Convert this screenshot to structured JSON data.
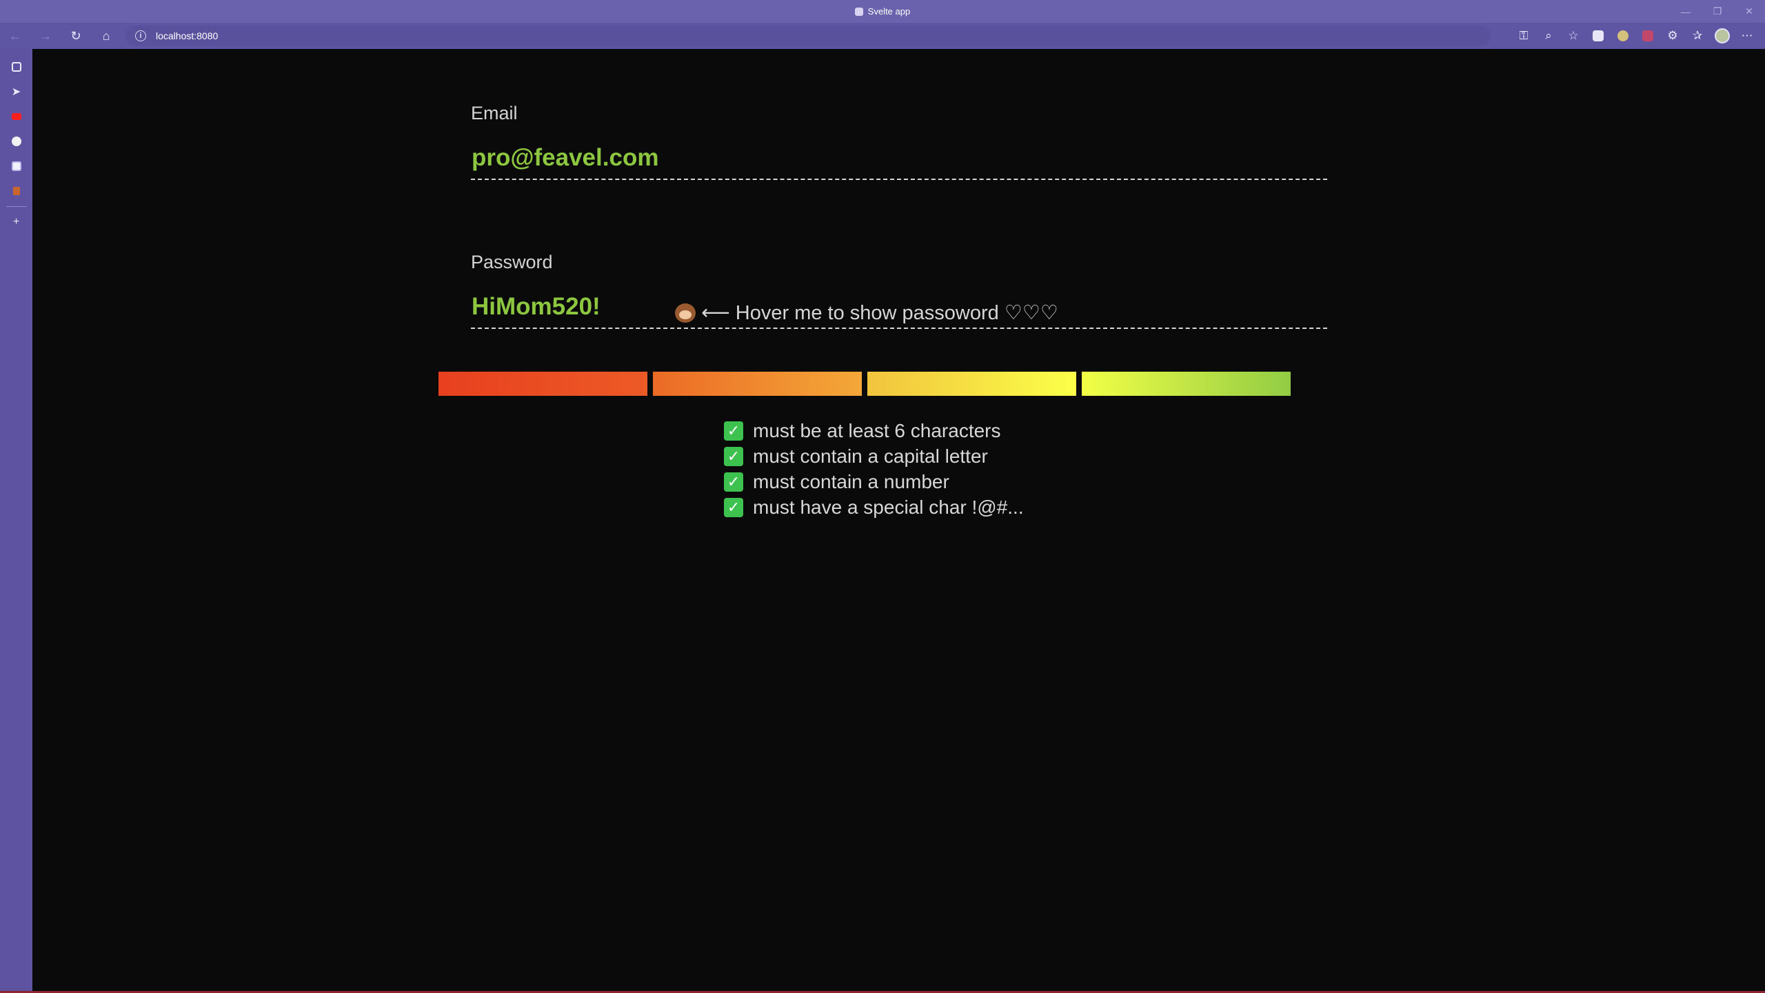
{
  "window": {
    "title": "Svelte app",
    "controls": [
      "—",
      "❐",
      "✕"
    ]
  },
  "toolbar": {
    "back": "←",
    "forward": "→",
    "reload": "↻",
    "home": "⌂",
    "url": "localhost:8080",
    "info": "i",
    "more": "⋯"
  },
  "sidebar": {
    "items": [
      "tab-manager",
      "sent",
      "youtube",
      "github",
      "svelte",
      "app"
    ],
    "add": "+"
  },
  "form": {
    "email_label": "Email",
    "email_value": "pro@feavel.com",
    "password_label": "Password",
    "password_value": "HiMom520!"
  },
  "hint": {
    "text": "⟵ Hover me to show passoword ♡♡♡"
  },
  "strength": {
    "segments": 4,
    "filled": 4
  },
  "rules": [
    {
      "text": "must be at least 6 characters",
      "checked": true
    },
    {
      "text": "must contain a capital letter",
      "checked": true
    },
    {
      "text": "must contain a number",
      "checked": true
    },
    {
      "text": "must have a special char !@#...",
      "checked": true
    }
  ],
  "colors": {
    "accent_green": "#8dc63f",
    "check_green": "#3ec24f",
    "chrome_purple": "#6b62ad",
    "background": "#0a0a0b"
  }
}
